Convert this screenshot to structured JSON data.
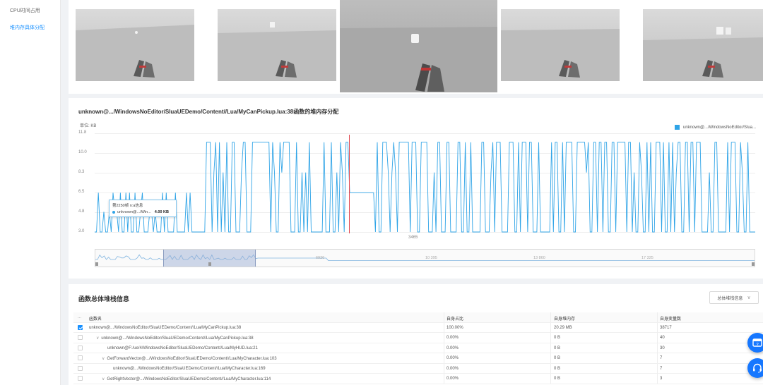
{
  "sidebar": {
    "items": [
      {
        "label": "CPU时间占用"
      },
      {
        "label": "堆内存具体分配"
      }
    ]
  },
  "frames": {
    "count": 5,
    "selected_index": 2
  },
  "chart_card": {
    "title": "unknown@.../WindowsNoEditor/SluaUEDemo/Content//Lua/MyCanPickup.lua:38函数的堆内存分配",
    "unit": "单位: KB",
    "legend": "unknown@.../WindowsNoEditor/Slua...",
    "tooltip": {
      "title": "第2250帧 n:a信息",
      "series": "unknown@.../Win...",
      "value": "4.00 KB"
    },
    "cursor_label": "3465",
    "zoom_ticks": [
      "6926",
      "10 395",
      "13 860",
      "17 325"
    ]
  },
  "chart_data": {
    "type": "line",
    "series": [
      {
        "name": "unknown@.../WindowsNoEditor/Slua...",
        "color": "#2fa4e7"
      }
    ],
    "ylabel": "单位: KB",
    "yticks": [
      "11.8",
      "10.0",
      "8.3",
      "6.5",
      "4.8",
      "3.0"
    ],
    "ylim": [
      3.0,
      11.8
    ],
    "x_marker": "3465",
    "grid": true,
    "legend_position": "top-right"
  },
  "table": {
    "title": "函数总体堆栈信息",
    "dropdown": "总体堆栈信息",
    "head_marker": "...",
    "columns": [
      "函数名",
      "自身占比",
      "自身堆内存",
      "自身变量数"
    ],
    "rows": [
      {
        "name": "unknown@.../WindowsNoEditor/SluaUEDemo/Content//Lua/MyCanPickup.lua:38",
        "pct": "100.00%",
        "mem": "20.29 MB",
        "vars": "38717",
        "checked": true,
        "caret": ""
      },
      {
        "name": "unknown@.../WindowsNoEditor/SluaUEDemo/Content//Lua/MyCanPickup.lua:38",
        "pct": "0.00%",
        "mem": "0 B",
        "vars": "40",
        "checked": false,
        "caret": "∨"
      },
      {
        "name": "unknown@F:/ue/4/WindowsNoEditor/SluaUEDemo/Content//Lua/MyHUD.lua:21",
        "pct": "0.00%",
        "mem": "0 B",
        "vars": "30",
        "checked": false,
        "caret": ""
      },
      {
        "name": "GetForwardVector@.../WindowsNoEditor/SluaUEDemo/Content//Lua/MyCharacter.lua:103",
        "pct": "0.00%",
        "mem": "0 B",
        "vars": "7",
        "checked": false,
        "caret": "∨"
      },
      {
        "name": "unknown@.../WindowsNoEditor/SluaUEDemo/Content//Lua/MyCharacter.lua:169",
        "pct": "0.00%",
        "mem": "0 B",
        "vars": "7",
        "checked": false,
        "caret": ""
      },
      {
        "name": "GetRightVector@.../WindowsNoEditor/SluaUEDemo/Content//Lua/MyCharacter.lua:114",
        "pct": "0.00%",
        "mem": "0 B",
        "vars": "3",
        "checked": false,
        "caret": "∨"
      }
    ]
  },
  "colors": {
    "accent": "#1890ff",
    "series_line": "#2fa4e7",
    "cursor": "#e0464f"
  },
  "floating_buttons": [
    {
      "icon": "feedback-icon"
    },
    {
      "icon": "headset-support-icon"
    }
  ]
}
